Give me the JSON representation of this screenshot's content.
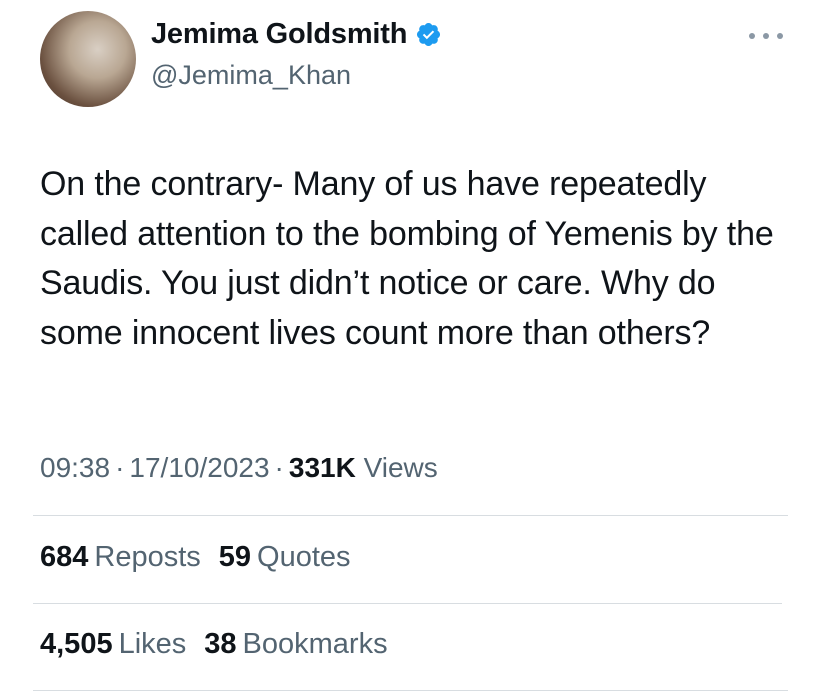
{
  "author": {
    "display_name": "Jemima Goldsmith",
    "handle": "@Jemima_Khan",
    "verified": true,
    "verified_icon": "verified-badge-icon",
    "verified_color": "#1d9bf0"
  },
  "tweet": {
    "text": "On the contrary- Many of us have repeatedly called attention to the bombing of Yemenis by the Saudis. You just didn’t notice or care. Why do some innocent lives count more than others?"
  },
  "meta": {
    "time": "09:38",
    "separator": "·",
    "date": "17/10/2023",
    "views_count": "331K",
    "views_label": "Views"
  },
  "stats": {
    "reposts": {
      "count": "684",
      "label": "Reposts"
    },
    "quotes": {
      "count": "59",
      "label": "Quotes"
    },
    "likes": {
      "count": "4,505",
      "label": "Likes"
    },
    "bookmarks": {
      "count": "38",
      "label": "Bookmarks"
    }
  },
  "colors": {
    "text_primary": "#0f1419",
    "text_secondary": "#536471",
    "divider": "#d8dde1"
  }
}
